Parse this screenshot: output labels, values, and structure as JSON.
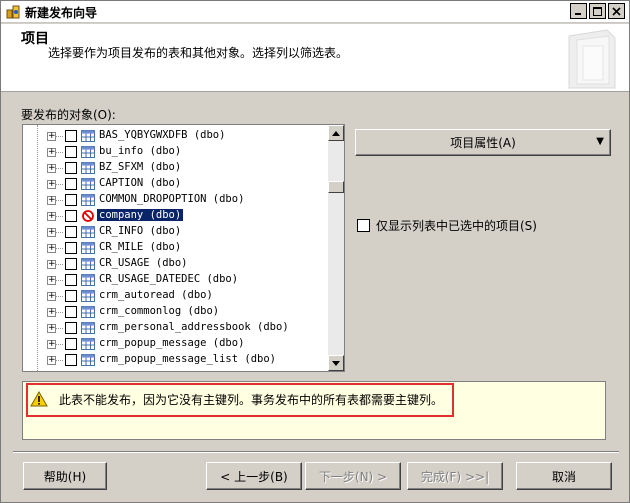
{
  "window": {
    "title": "新建发布向导"
  },
  "header": {
    "title": "项目",
    "description": "选择要作为项目发布的表和其他对象。选择列以筛选表。"
  },
  "objects_label": "要发布的对象(O):",
  "tree_items": [
    {
      "label": "BAS_YQBYGWXDFB (dbo)",
      "icon": "table-icon"
    },
    {
      "label": "bu_info (dbo)",
      "icon": "table-icon"
    },
    {
      "label": "BZ_SFXM (dbo)",
      "icon": "table-icon"
    },
    {
      "label": "CAPTION (dbo)",
      "icon": "table-icon"
    },
    {
      "label": "COMMON_DROPOPTION (dbo)",
      "icon": "table-icon"
    },
    {
      "label": "company (dbo)",
      "icon": "no-publish-icon",
      "selected": true
    },
    {
      "label": "CR_INFO (dbo)",
      "icon": "table-icon"
    },
    {
      "label": "CR_MILE (dbo)",
      "icon": "table-icon"
    },
    {
      "label": "CR_USAGE (dbo)",
      "icon": "table-icon"
    },
    {
      "label": "CR_USAGE_DATEDEC (dbo)",
      "icon": "table-icon"
    },
    {
      "label": "crm_autoread (dbo)",
      "icon": "table-icon"
    },
    {
      "label": "crm_commonlog (dbo)",
      "icon": "table-icon"
    },
    {
      "label": "crm_personal_addressbook (dbo)",
      "icon": "table-icon"
    },
    {
      "label": "crm_popup_message (dbo)",
      "icon": "table-icon"
    },
    {
      "label": "crm_popup_message_list (dbo)",
      "icon": "table-icon"
    }
  ],
  "item_properties_button": "项目属性(A)",
  "show_only_checked_label": "仅显示列表中已选中的项目(S)",
  "message": "此表不能发布，因为它没有主键列。事务发布中的所有表都需要主键列。",
  "buttons": {
    "help": "帮助(H)",
    "back": "< 上一步(B)",
    "next": "下一步(N) >",
    "finish": "完成(F) >>|",
    "cancel": "取消"
  },
  "colors": {
    "highlight_border": "#e03030",
    "message_bg": "#ffffe1",
    "selection": "#0a246a"
  }
}
